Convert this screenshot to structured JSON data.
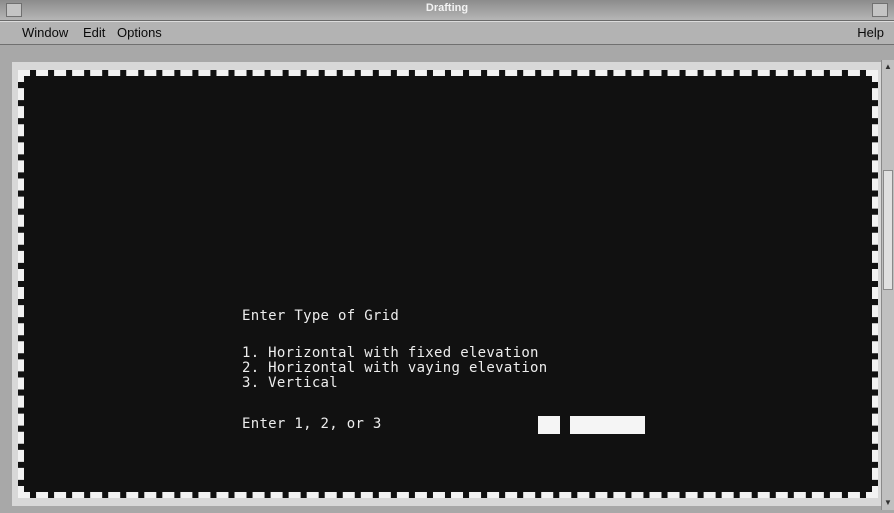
{
  "window": {
    "title": "Drafting"
  },
  "menubar": {
    "window_label": "Window",
    "edit_label": "Edit",
    "options_label": "Options",
    "help_label": "Help"
  },
  "terminal": {
    "heading": "Enter Type of Grid",
    "options": [
      "1. Horizontal with fixed elevation",
      "2. Horizontal with vaying elevation",
      "3. Vertical"
    ],
    "entry_prompt": "Enter 1, 2, or 3",
    "entry_value": "",
    "secondary_value": ""
  },
  "colors": {
    "terminal_bg": "#111111",
    "terminal_text": "#ededed",
    "border_dots": "#f2f2f2",
    "chrome": "#b3b3b3"
  }
}
